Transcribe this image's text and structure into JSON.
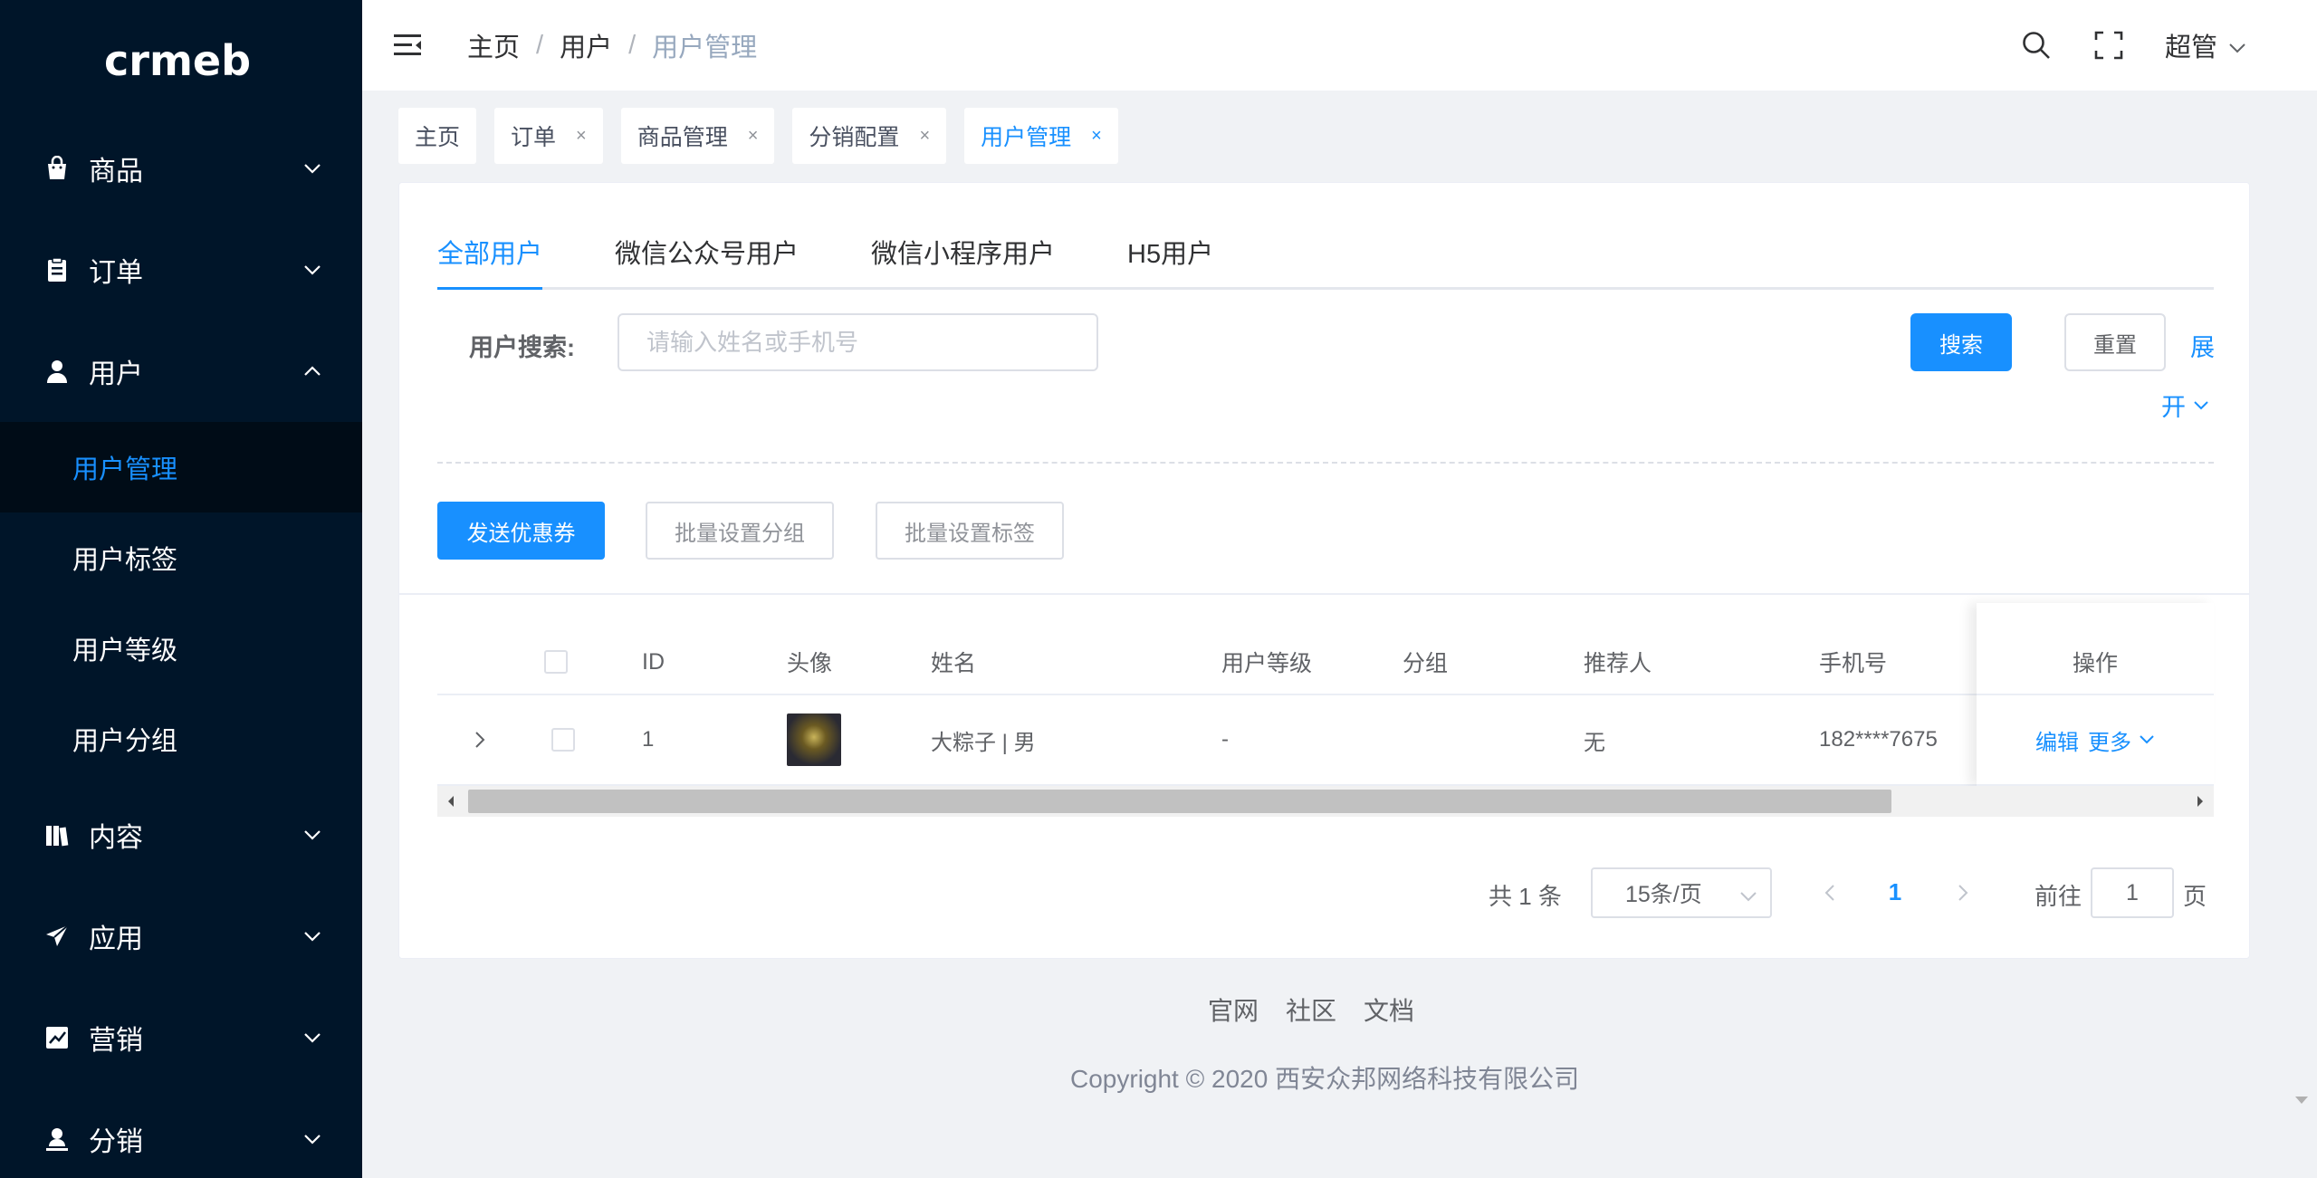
{
  "sidebar": {
    "logo": "crmeb",
    "items": [
      {
        "label": "商品",
        "icon": "shopping-bag-icon"
      },
      {
        "label": "订单",
        "icon": "clipboard-icon"
      },
      {
        "label": "用户",
        "icon": "user-icon"
      },
      {
        "label": "内容",
        "icon": "book-icon"
      },
      {
        "label": "应用",
        "icon": "paper-plane-icon"
      },
      {
        "label": "营销",
        "icon": "chart-icon"
      },
      {
        "label": "分销",
        "icon": "person-badge-icon"
      }
    ],
    "user_submenu": [
      {
        "label": "用户管理"
      },
      {
        "label": "用户标签"
      },
      {
        "label": "用户等级"
      },
      {
        "label": "用户分组"
      }
    ]
  },
  "header": {
    "breadcrumb": [
      "主页",
      "用户",
      "用户管理"
    ],
    "user": "超管"
  },
  "tags": [
    {
      "label": "主页"
    },
    {
      "label": "订单"
    },
    {
      "label": "商品管理"
    },
    {
      "label": "分销配置"
    },
    {
      "label": "用户管理"
    }
  ],
  "tabs": [
    "全部用户",
    "微信公众号用户",
    "微信小程序用户",
    "H5用户"
  ],
  "search": {
    "label": "用户搜索:",
    "placeholder": "请输入姓名或手机号",
    "search_btn": "搜索",
    "reset_btn": "重置",
    "expand_1": "展",
    "expand_2": "开"
  },
  "actions": {
    "send_coupon": "发送优惠券",
    "batch_group": "批量设置分组",
    "batch_tag": "批量设置标签"
  },
  "table": {
    "columns": [
      "ID",
      "头像",
      "姓名",
      "用户等级",
      "分组",
      "推荐人",
      "手机号",
      "操作"
    ],
    "rows": [
      {
        "id": "1",
        "name": "大粽子 | 男",
        "level": "-",
        "group": "",
        "referrer": "无",
        "phone": "182****7675",
        "edit": "编辑",
        "more": "更多"
      }
    ]
  },
  "pagination": {
    "total": "共 1 条",
    "page_size": "15条/页",
    "current": "1",
    "goto_label": "前往",
    "goto_value": "1",
    "page_suffix": "页"
  },
  "footer": {
    "links": [
      "官网",
      "社区",
      "文档"
    ],
    "copyright": "Copyright © 2020 西安众邦网络科技有限公司"
  },
  "colors": {
    "sidebar_bg": "#001529",
    "submenu_bg": "#000c17",
    "primary": "#1890ff"
  }
}
